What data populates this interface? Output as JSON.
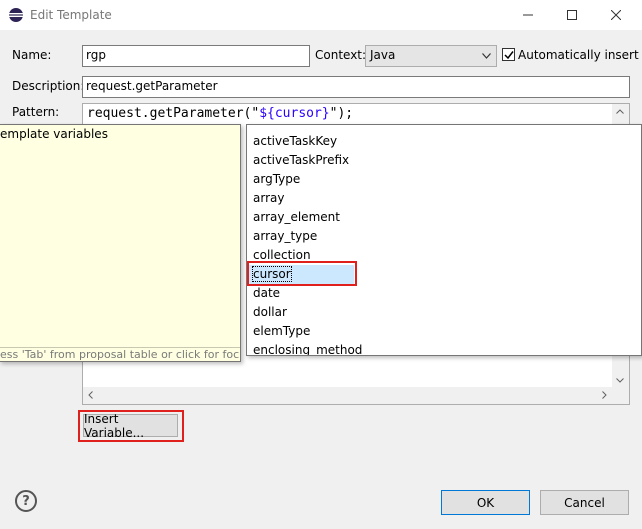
{
  "window": {
    "title": "Edit Template",
    "minimize": "—",
    "maximize": "☐",
    "close": "✕"
  },
  "form": {
    "name_label": "Name:",
    "name_value": "rgp",
    "context_label": "Context:",
    "context_value": "Java",
    "auto_insert_label": "Automatically insert",
    "auto_insert_checked": "✓",
    "description_label": "Description:",
    "description_value": "request.getParameter",
    "pattern_label": "Pattern:",
    "pattern_prefix": "request.getParameter(\"",
    "pattern_variable": "${cursor}",
    "pattern_suffix": "\");"
  },
  "help_popup": {
    "text": "emplate variables",
    "footer": "ess 'Tab' from proposal table or click for focus"
  },
  "variables": {
    "items": [
      "activeTaskKey",
      "activeTaskPrefix",
      "argType",
      "array",
      "array_element",
      "array_type",
      "collection",
      "cursor",
      "date",
      "dollar",
      "elemType",
      "enclosing_method"
    ],
    "selected": "cursor"
  },
  "buttons": {
    "insert_variable": "Insert Variable...",
    "ok": "OK",
    "cancel": "Cancel",
    "help": "?"
  },
  "colors": {
    "selection": "#cce8ff",
    "highlight_red": "#e0201c",
    "variable_blue": "#2a00ff",
    "tooltip_yellow": "#ffffe1"
  }
}
